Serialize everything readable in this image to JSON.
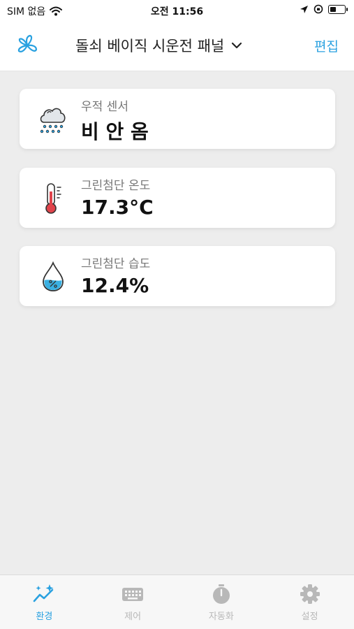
{
  "status_bar": {
    "carrier": "SIM 없음",
    "time": "오전 11:56"
  },
  "nav": {
    "title": "돌쇠 베이직 시운전 패널",
    "edit_label": "편집"
  },
  "sensors": [
    {
      "label": "우적 센서",
      "value": "비 안 옴",
      "icon": "rain-cloud-icon"
    },
    {
      "label": "그린첨단 온도",
      "value": "17.3°C",
      "icon": "thermometer-icon"
    },
    {
      "label": "그린첨단 습도",
      "value": "12.4%",
      "icon": "water-drop-icon"
    }
  ],
  "tabs": [
    {
      "label": "환경",
      "icon": "sparkle-chart-icon",
      "active": true
    },
    {
      "label": "제어",
      "icon": "keyboard-icon",
      "active": false
    },
    {
      "label": "자동화",
      "icon": "stopwatch-icon",
      "active": false
    },
    {
      "label": "설정",
      "icon": "gear-icon",
      "active": false
    }
  ],
  "colors": {
    "accent": "#2aa1e0",
    "background": "#ededed",
    "inactive": "#b8b8b8"
  }
}
